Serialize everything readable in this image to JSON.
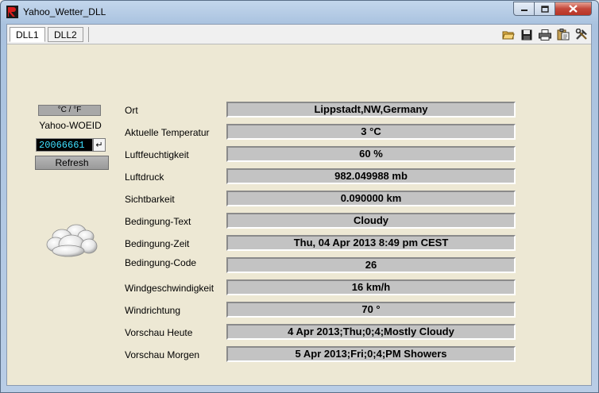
{
  "window": {
    "title": "Yahoo_Wetter_DLL",
    "minimize": "0",
    "maximize": "1",
    "close": "X"
  },
  "tabs": [
    {
      "label": "DLL1"
    },
    {
      "label": "DLL2"
    }
  ],
  "toolbar_icons": [
    "open-folder-icon",
    "save-icon",
    "print-icon",
    "clipboard-icon",
    "tools-icon"
  ],
  "sidebar": {
    "unit_toggle": "°C / °F",
    "woeid_label": "Yahoo-WOEID",
    "woeid_value": "20066661",
    "enter_glyph": "↵",
    "refresh_label": "Refresh",
    "weather_icon": "cloudy-icon"
  },
  "fields": [
    {
      "label": "Ort",
      "value": "Lippstadt,NW,Germany"
    },
    {
      "label": "Aktuelle Temperatur",
      "value": "3 °C"
    },
    {
      "label": "Luftfeuchtigkeit",
      "value": "60 %"
    },
    {
      "label": "Luftdruck",
      "value": "982.049988 mb"
    },
    {
      "label": "Sichtbarkeit",
      "value": "0.090000 km"
    },
    {
      "label": "Bedingung-Text",
      "value": "Cloudy"
    },
    {
      "label": "Bedingung-Zeit",
      "value": "Thu, 04 Apr 2013 8:49 pm CEST"
    },
    {
      "label": "Bedingung-Code",
      "value": "26"
    },
    {
      "label": "Windgeschwindigkeit",
      "value": "16 km/h"
    },
    {
      "label": "Windrichtung",
      "value": "70 °"
    },
    {
      "label": "Vorschau Heute",
      "value": "4 Apr 2013;Thu;0;4;Mostly Cloudy"
    },
    {
      "label": "Vorschau Morgen",
      "value": "5 Apr 2013;Fri;0;4;PM Showers"
    }
  ]
}
